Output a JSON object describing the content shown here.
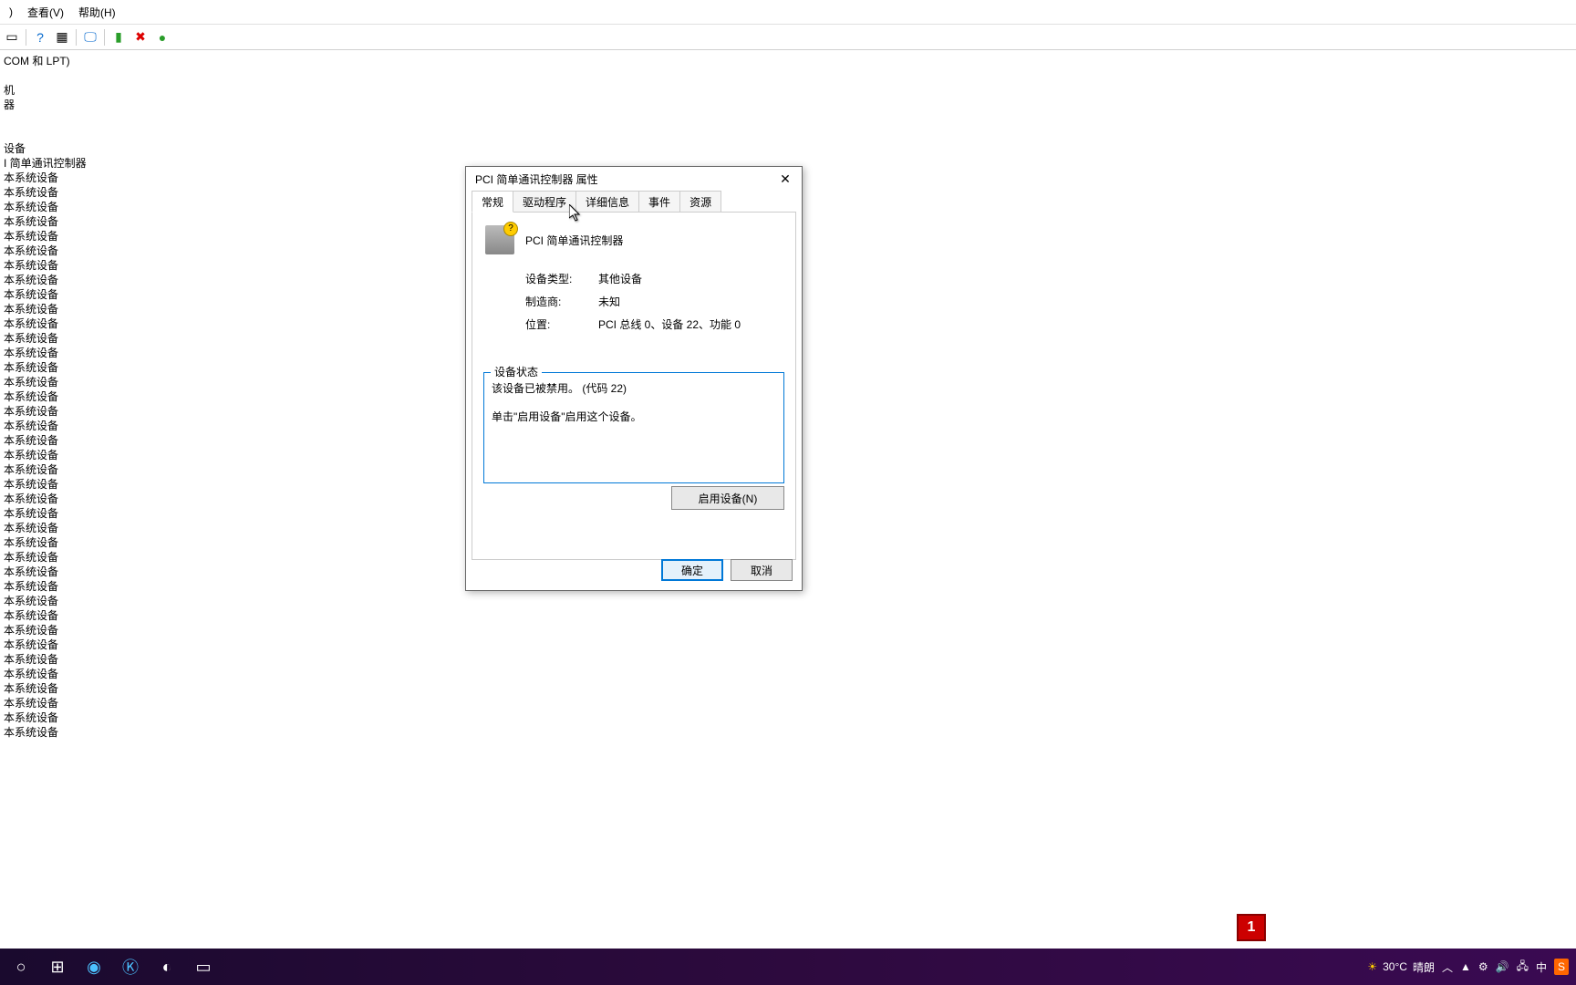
{
  "menu": {
    "view": "查看(V)",
    "help": "帮助(H)",
    "a": ")"
  },
  "tree": {
    "root": "COM 和 LPT)",
    "n1": "机",
    "n2": "器",
    "cat": "设备",
    "pci": "I 简单通讯控制器",
    "sys": "本系统设备"
  },
  "dialog": {
    "title": "PCI 简单通讯控制器 属性",
    "tabs": {
      "general": "常规",
      "driver": "驱动程序",
      "details": "详细信息",
      "events": "事件",
      "resources": "资源"
    },
    "devname": "PCI 简单通讯控制器",
    "props": {
      "type_k": "设备类型:",
      "type_v": "其他设备",
      "mfr_k": "制造商:",
      "mfr_v": "未知",
      "loc_k": "位置:",
      "loc_v": "PCI 总线 0、设备 22、功能 0"
    },
    "status_label": "设备状态",
    "status_text": "该设备已被禁用。 (代码 22)\n\n单击\"启用设备\"启用这个设备。",
    "enable": "启用设备(N)",
    "ok": "确定",
    "cancel": "取消"
  },
  "taskbar": {
    "temp": "30°C",
    "weather": "晴朗",
    "ime": "中"
  },
  "badge": "1"
}
